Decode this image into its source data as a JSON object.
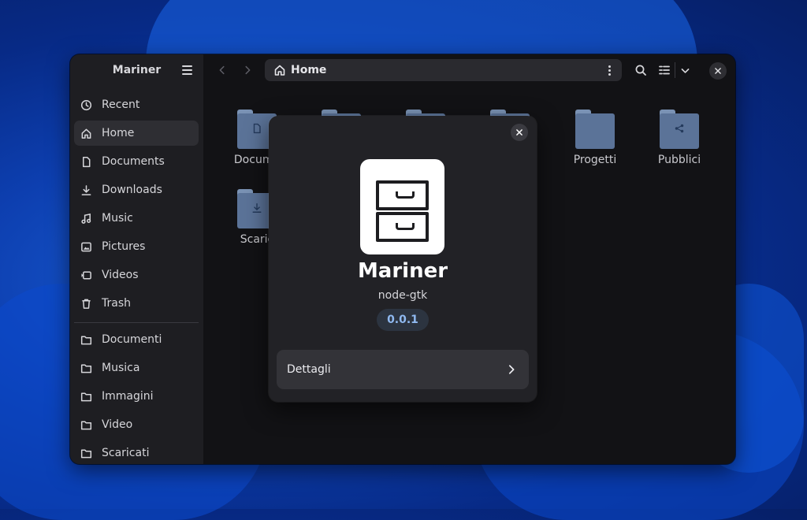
{
  "window": {
    "title": "Mariner",
    "path_label": "Home"
  },
  "sidebar": {
    "items": [
      {
        "label": "Recent",
        "icon": "clock-icon"
      },
      {
        "label": "Home",
        "icon": "home-icon",
        "active": true
      },
      {
        "label": "Documents",
        "icon": "document-icon"
      },
      {
        "label": "Downloads",
        "icon": "download-icon"
      },
      {
        "label": "Music",
        "icon": "music-icon"
      },
      {
        "label": "Pictures",
        "icon": "picture-icon"
      },
      {
        "label": "Videos",
        "icon": "video-icon"
      },
      {
        "label": "Trash",
        "icon": "trash-icon"
      }
    ],
    "bookmarks": [
      {
        "label": "Documenti",
        "icon": "folder-icon"
      },
      {
        "label": "Musica",
        "icon": "folder-icon"
      },
      {
        "label": "Immagini",
        "icon": "folder-icon"
      },
      {
        "label": "Video",
        "icon": "folder-icon"
      },
      {
        "label": "Scaricati",
        "icon": "folder-icon"
      }
    ]
  },
  "folders": [
    {
      "label": "Documenti",
      "visible_label": "Docume",
      "icon": "document-emblem"
    },
    {
      "label": "Progetti",
      "icon": "folder"
    },
    {
      "label": "Pubblici",
      "icon": "share-emblem"
    },
    {
      "label": "Scaricati",
      "visible_label": "Scaric",
      "icon": "download-emblem"
    }
  ],
  "about_dialog": {
    "app_name": "Mariner",
    "developer": "node-gtk",
    "version": "0.0.1",
    "details_label": "Dettagli",
    "icon": "file-cabinet-icon"
  },
  "colors": {
    "accent": "#8fb9f0",
    "folder": "#5b7398"
  }
}
